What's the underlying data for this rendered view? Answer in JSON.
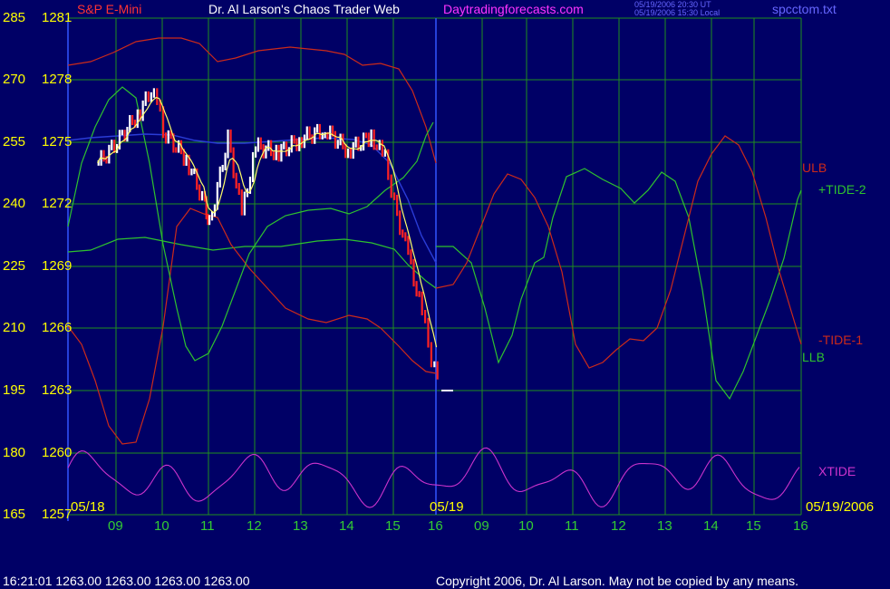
{
  "header": {
    "instrument": "S&P E-Mini",
    "title": "Dr. Al Larson's Chaos Trader Web",
    "site": "Daytradingforecasts.com",
    "timestamp_line1": "05/19/2006 20:30 UT",
    "timestamp_line2": "05/19/2006 15:30 Local",
    "filename": "spcctom.txt"
  },
  "colors": {
    "background": "#000066",
    "grid": "#1f8f1f",
    "price_up": "#ffffff",
    "price_down": "#ff2222",
    "yellow_ma": "#ffff66",
    "blue_ma": "#2a3cd6",
    "red_line": "#cc2a1a",
    "green_line": "#2ec22e",
    "xtide": "#cc33cc",
    "left_axis": "#ffff00",
    "bottom_axis": "#33cc33",
    "header_red": "#ff3333",
    "header_magenta": "#ff33ff",
    "header_blue": "#6666ff"
  },
  "footer": {
    "status": "16:21:01  1263.00 1263.00 1263.00 1263.00",
    "copyright": "Copyright 2006, Dr. Al Larson. May not be copied by any means."
  },
  "chart_data": {
    "type": "line",
    "title": "Dr. Al Larson's Chaos Trader Web",
    "y_axis_left_ticks": [
      285,
      270,
      255,
      240,
      225,
      210,
      195,
      180,
      165
    ],
    "y_axis_price_ticks": [
      1281,
      1278,
      1275,
      1272,
      1269,
      1266,
      1263,
      1260,
      1257
    ],
    "price_range": [
      1257,
      1281
    ],
    "x_ticks": [
      "09",
      "10",
      "11",
      "12",
      "13",
      "14",
      "15",
      "16",
      "09",
      "10",
      "11",
      "12",
      "13",
      "14",
      "15",
      "16"
    ],
    "date_labels": [
      "05/18",
      "05/19",
      "05/19/2006"
    ],
    "last_price": 1263.0,
    "price_bars_05_18": [
      {
        "hour": "08.6",
        "close": 1274.0
      },
      {
        "hour": "09",
        "close": 1275.0
      },
      {
        "hour": "09.5",
        "close": 1276.5
      },
      {
        "hour": "09.8",
        "close": 1277.8
      },
      {
        "hour": "10",
        "close": 1275.5
      },
      {
        "hour": "10.5",
        "close": 1274.2
      },
      {
        "hour": "10.9",
        "close": 1272.0
      },
      {
        "hour": "11",
        "close": 1271.0
      },
      {
        "hour": "11.4",
        "close": 1275.2
      },
      {
        "hour": "11.7",
        "close": 1271.5
      },
      {
        "hour": "12",
        "close": 1274.8
      },
      {
        "hour": "12.5",
        "close": 1274.5
      },
      {
        "hour": "13",
        "close": 1275.2
      },
      {
        "hour": "13.5",
        "close": 1275.6
      },
      {
        "hour": "14",
        "close": 1274.6
      },
      {
        "hour": "14.5",
        "close": 1275.3
      },
      {
        "hour": "14.8",
        "close": 1274.2
      },
      {
        "hour": "15",
        "close": 1272.0
      },
      {
        "hour": "15.3",
        "close": 1269.5
      },
      {
        "hour": "15.6",
        "close": 1266.8
      },
      {
        "hour": "15.8",
        "close": 1264.5
      },
      {
        "hour": "16",
        "close": 1263.0
      }
    ],
    "series": [
      {
        "name": "ULB"
      },
      {
        "name": "+TIDE-2"
      },
      {
        "name": "-TIDE-1"
      },
      {
        "name": "LLB"
      },
      {
        "name": "XTIDE"
      }
    ]
  }
}
